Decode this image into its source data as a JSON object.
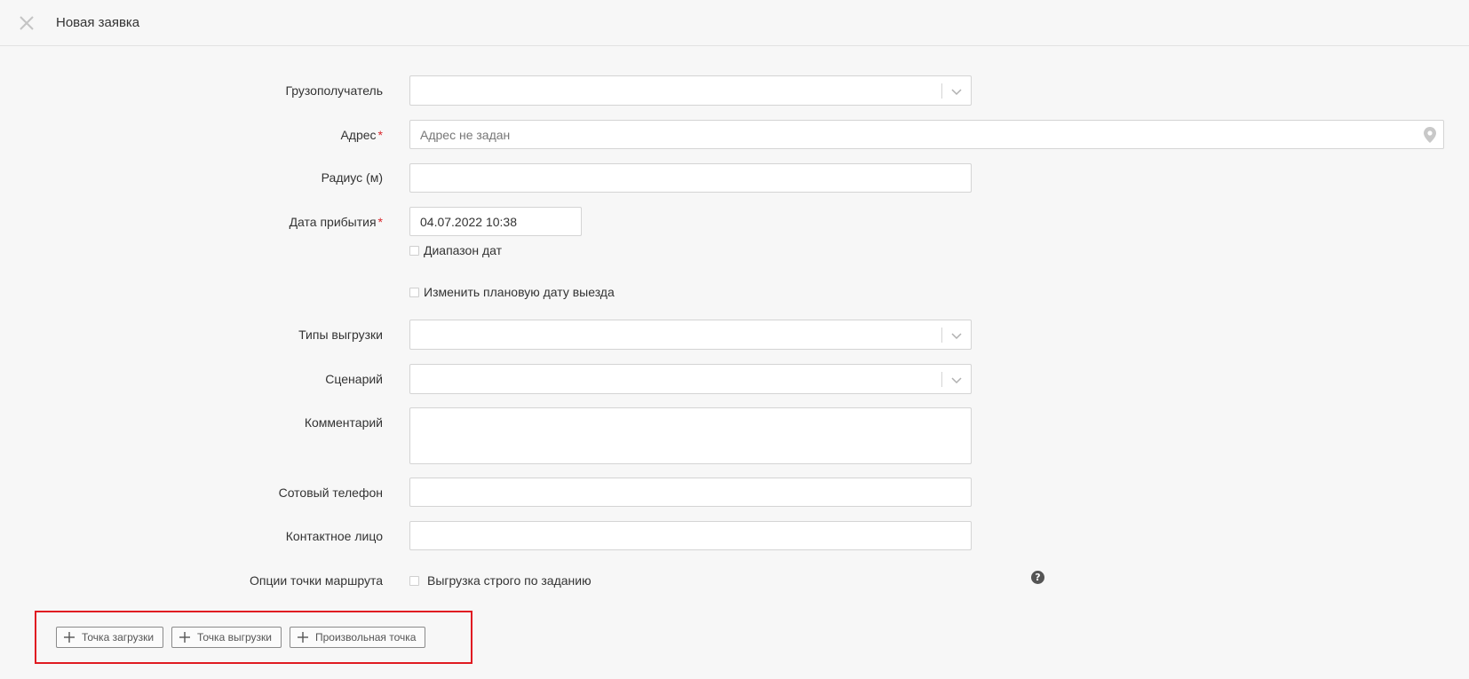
{
  "header": {
    "title": "Новая заявка"
  },
  "form": {
    "consignee": {
      "label": "Грузополучатель",
      "value": ""
    },
    "address": {
      "label": "Адрес",
      "required_mark": "*",
      "placeholder": "Адрес не задан"
    },
    "radius": {
      "label": "Радиус (м)",
      "value": ""
    },
    "arrival_date": {
      "label": "Дата прибытия",
      "required_mark": "*",
      "value": "04.07.2022 10:38"
    },
    "date_range": {
      "label": "Диапазон дат",
      "checked": false
    },
    "change_departure": {
      "label": "Изменить плановую дату выезда",
      "checked": false
    },
    "unload_types": {
      "label": "Типы выгрузки",
      "value": ""
    },
    "scenario": {
      "label": "Сценарий",
      "value": ""
    },
    "comment": {
      "label": "Комментарий",
      "value": ""
    },
    "phone": {
      "label": "Сотовый телефон",
      "value": ""
    },
    "contact": {
      "label": "Контактное лицо",
      "value": ""
    },
    "route_options": {
      "label": "Опции точки маршрута",
      "strict_unload_label": "Выгрузка строго по заданию",
      "checked": false
    },
    "help_glyph": "?"
  },
  "actions": {
    "load_point": "Точка загрузки",
    "unload_point": "Точка выгрузки",
    "custom_point": "Произвольная точка"
  },
  "icons": {
    "close": "close-icon",
    "chevron": "chevron-down-icon",
    "pin": "map-pin-icon",
    "help": "help-icon",
    "plus": "plus-icon"
  },
  "colors": {
    "required": "#d9262c",
    "highlight_frame": "#e01b22",
    "background": "#f7f7f7"
  }
}
